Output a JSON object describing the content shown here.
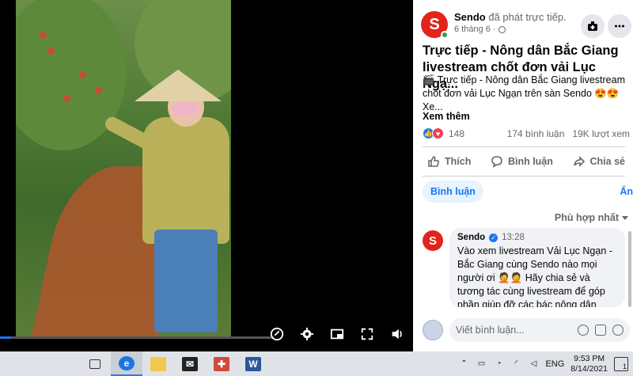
{
  "post": {
    "page_name": "Sendo",
    "action_text": "đã phát trực tiếp.",
    "date": "6 tháng 6",
    "title": "Trực tiếp - Nông dân Bắc Giang livestream chốt đơn vải Lục Ngạ...",
    "description": "🎬 Trực tiếp - Nông dân Bắc Giang livestream chốt đơn vải Lục Ngạn trên sàn Sendo 😍😍 Xe...",
    "see_more": "Xem thêm",
    "reaction_count": "148",
    "comment_count": "174 bình luận",
    "view_count": "19K lượt xem"
  },
  "actions": {
    "like": "Thích",
    "comment": "Bình luận",
    "share": "Chia sẻ"
  },
  "tabs": {
    "comments": "Bình luận",
    "hide": "Ẩn"
  },
  "sort": {
    "label": "Phù hợp nhất"
  },
  "comment": {
    "author": "Sendo",
    "time": "13:28",
    "text": "Vào xem livestream Vải Lục Ngạn - Bắc Giang cùng Sendo nào mọi người ơi 🤦🤦 Hãy chia sẻ và tương tác cùng livestream để góp phần giúp đỡ các bác nông dân"
  },
  "compose": {
    "placeholder": "Viết bình luận..."
  },
  "video": {
    "progress": 0.04
  },
  "taskbar": {
    "language": "ENG",
    "time": "9:53 PM",
    "date": "8/14/2021",
    "notifications": "1"
  },
  "colors": {
    "facebook_blue": "#1877f2",
    "sendo_red": "#e2241b",
    "muted_text": "#65676b"
  }
}
